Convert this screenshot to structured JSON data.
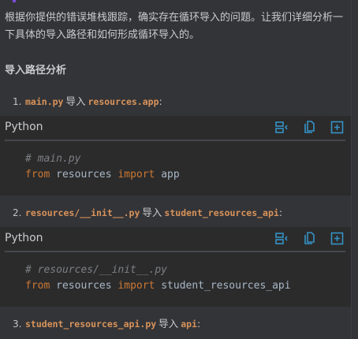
{
  "intro": "根据你提供的错误堆栈跟踪，确实存在循环导入的问题。让我们详细分析一下具体的导入路径和如何形成循环导入的。",
  "heading": "导入路径分析",
  "steps": [
    {
      "num": "1.",
      "from": "main.py",
      "verb": "导入",
      "target": "resources.app",
      "colon": ":"
    },
    {
      "num": "2.",
      "from": "resources/__init__.py",
      "verb": "导入",
      "target": "student_resources_api",
      "colon": ":"
    },
    {
      "num": "3.",
      "from": "student_resources_api.py",
      "verb": "导入",
      "target": "api",
      "colon": ":"
    }
  ],
  "code_blocks": [
    {
      "lang": "Python",
      "comment": "# main.py",
      "kw1": "from",
      "module": "resources",
      "kw2": "import",
      "name": "app"
    },
    {
      "lang": "Python",
      "comment": "# resources/__init__.py",
      "kw1": "from",
      "module": "resources",
      "kw2": "import",
      "name": "student_resources_api"
    }
  ],
  "icons": [
    "insert-at-caret-icon",
    "copy-icon",
    "new-file-icon"
  ],
  "colors": {
    "background": "#333438",
    "code_bg": "#2b2b2c",
    "keyword": "#cc7832",
    "inline_code": "#d8935a",
    "icon": "#3592c4"
  }
}
